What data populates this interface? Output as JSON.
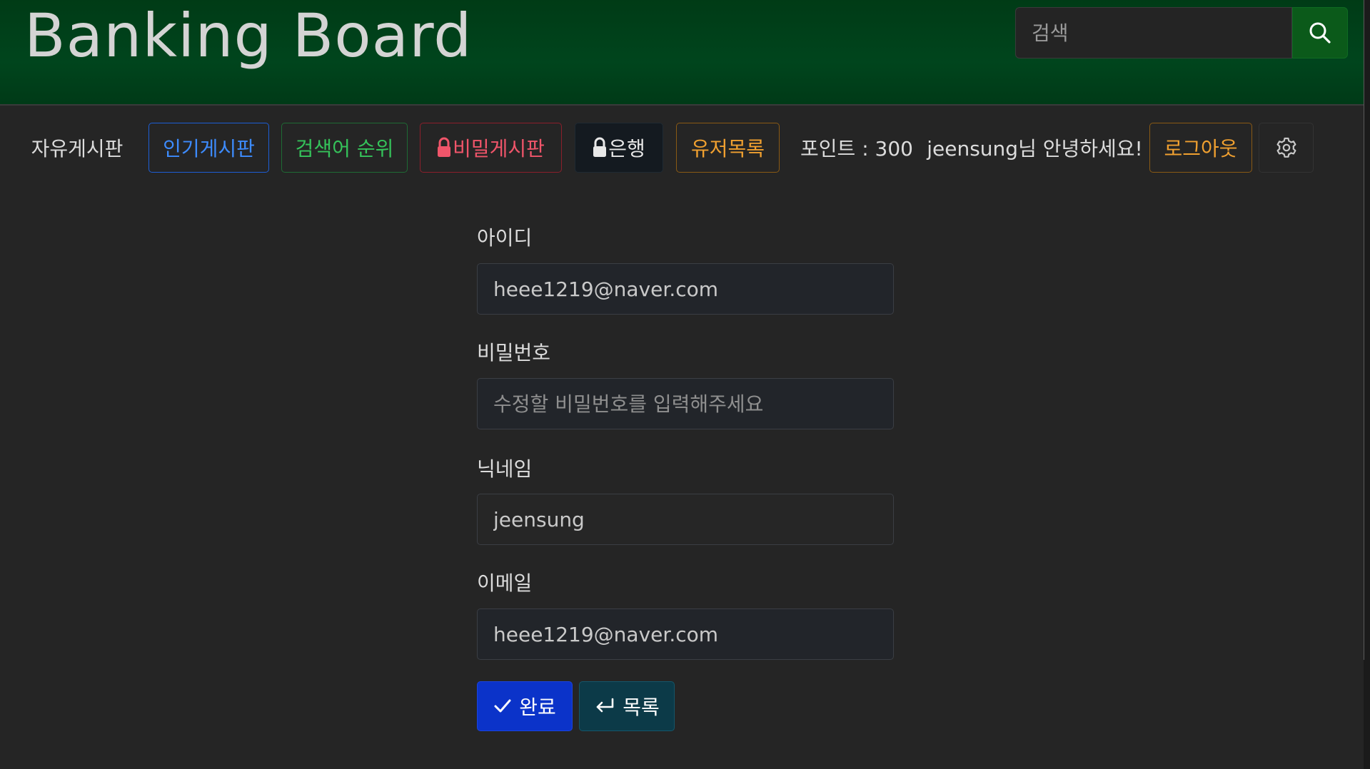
{
  "header": {
    "title": "Banking Board",
    "search": {
      "placeholder": "검색",
      "value": ""
    }
  },
  "nav": {
    "free_board": "자유게시판",
    "popular_board": "인기게시판",
    "search_ranking": "검색어 순위",
    "secret_board": "비밀게시판",
    "bank": "은행",
    "user_list": "유저목록",
    "points": "포인트 : 300",
    "greeting": "jeensung님 안녕하세요!",
    "logout": "로그아웃"
  },
  "form": {
    "id": {
      "label": "아이디",
      "value": "heee1219@naver.com"
    },
    "password": {
      "label": "비밀번호",
      "placeholder": "수정할 비밀번호를 입력해주세요",
      "value": ""
    },
    "nickname": {
      "label": "닉네임",
      "value": "jeensung"
    },
    "email": {
      "label": "이메일",
      "value": "heee1219@naver.com"
    },
    "submit_label": "완료",
    "list_label": "목록"
  },
  "colors": {
    "header_bg": "#00451d",
    "page_bg": "#252525",
    "primary": "#0b33c9",
    "teal": "#0c3a48",
    "blue": "#3d8bfd",
    "green": "#35c25a",
    "red": "#f0556a",
    "orange": "#f0a030"
  },
  "icons": {
    "search": "search-icon",
    "lock": "lock-icon",
    "settings": "gear-icon",
    "check": "check-icon",
    "return": "return-arrow-icon"
  }
}
